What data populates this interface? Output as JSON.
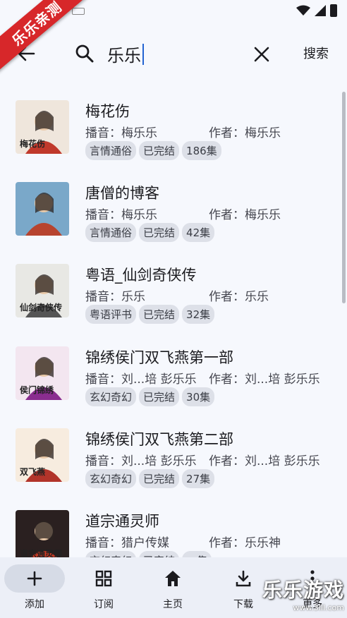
{
  "ribbon": {
    "label": "乐乐亲测"
  },
  "search": {
    "query": "乐乐",
    "submit_label": "搜索"
  },
  "results": [
    {
      "title": "梅花伤",
      "narrator": "播音：梅乐乐",
      "author": "作者：梅乐乐",
      "tags": [
        "言情通俗",
        "已完结",
        "186集"
      ],
      "cover_text": "梅花伤",
      "cover_colors": [
        "#efe6dc",
        "#c0392b"
      ]
    },
    {
      "title": "唐僧的博客",
      "narrator": "播音：梅乐乐",
      "author": "作者：梅乐乐",
      "tags": [
        "言情通俗",
        "已完结",
        "42集"
      ],
      "cover_text": "",
      "cover_colors": [
        "#7aa8c9",
        "#b7442f"
      ]
    },
    {
      "title": "粤语_仙剑奇侠传",
      "narrator": "播音：乐乐",
      "author": "作者：乐乐",
      "tags": [
        "粤语评书",
        "已完结",
        "32集"
      ],
      "cover_text": "仙剑奇侠传",
      "cover_colors": [
        "#e8e8e4",
        "#555555"
      ]
    },
    {
      "title": "锦绣侯门双飞燕第一部",
      "narrator": "播音：刘...培 彭乐乐",
      "author": "作者：刘...培 彭乐乐",
      "tags": [
        "玄幻奇幻",
        "已完结",
        "30集"
      ],
      "cover_text": "侯门锦绣",
      "cover_colors": [
        "#f3e6f0",
        "#8a2d8f"
      ]
    },
    {
      "title": "锦绣侯门双飞燕第二部",
      "narrator": "播音：刘...培 彭乐乐",
      "author": "作者：刘...培 彭乐乐",
      "tags": [
        "玄幻奇幻",
        "已完结",
        "27集"
      ],
      "cover_text": "双飞燕",
      "cover_colors": [
        "#f7ecdf",
        "#b2342a"
      ]
    },
    {
      "title": "道宗通灵师",
      "narrator": "播音：猎户传媒",
      "author": "作者：乐乐神",
      "tags": [
        "玄幻奇幻",
        "已完结",
        "…集"
      ],
      "cover_text": "道宗通灵师",
      "cover_colors": [
        "#2a2020",
        "#c43a25"
      ]
    }
  ],
  "nav": [
    {
      "label": "添加",
      "icon": "plus-icon",
      "active": true
    },
    {
      "label": "订阅",
      "icon": "grid-icon",
      "active": false
    },
    {
      "label": "主页",
      "icon": "home-icon",
      "active": false
    },
    {
      "label": "下载",
      "icon": "download-icon",
      "active": false
    },
    {
      "label": "更多",
      "icon": "more-vert-icon",
      "active": false
    }
  ],
  "watermark": {
    "text": "乐乐游戏",
    "url": "www.3lll.com"
  },
  "colors": {
    "accent": "#2364d2",
    "ribbon": "#d7272a",
    "background": "#f6f8fd",
    "nav_bg": "#eceff7"
  }
}
